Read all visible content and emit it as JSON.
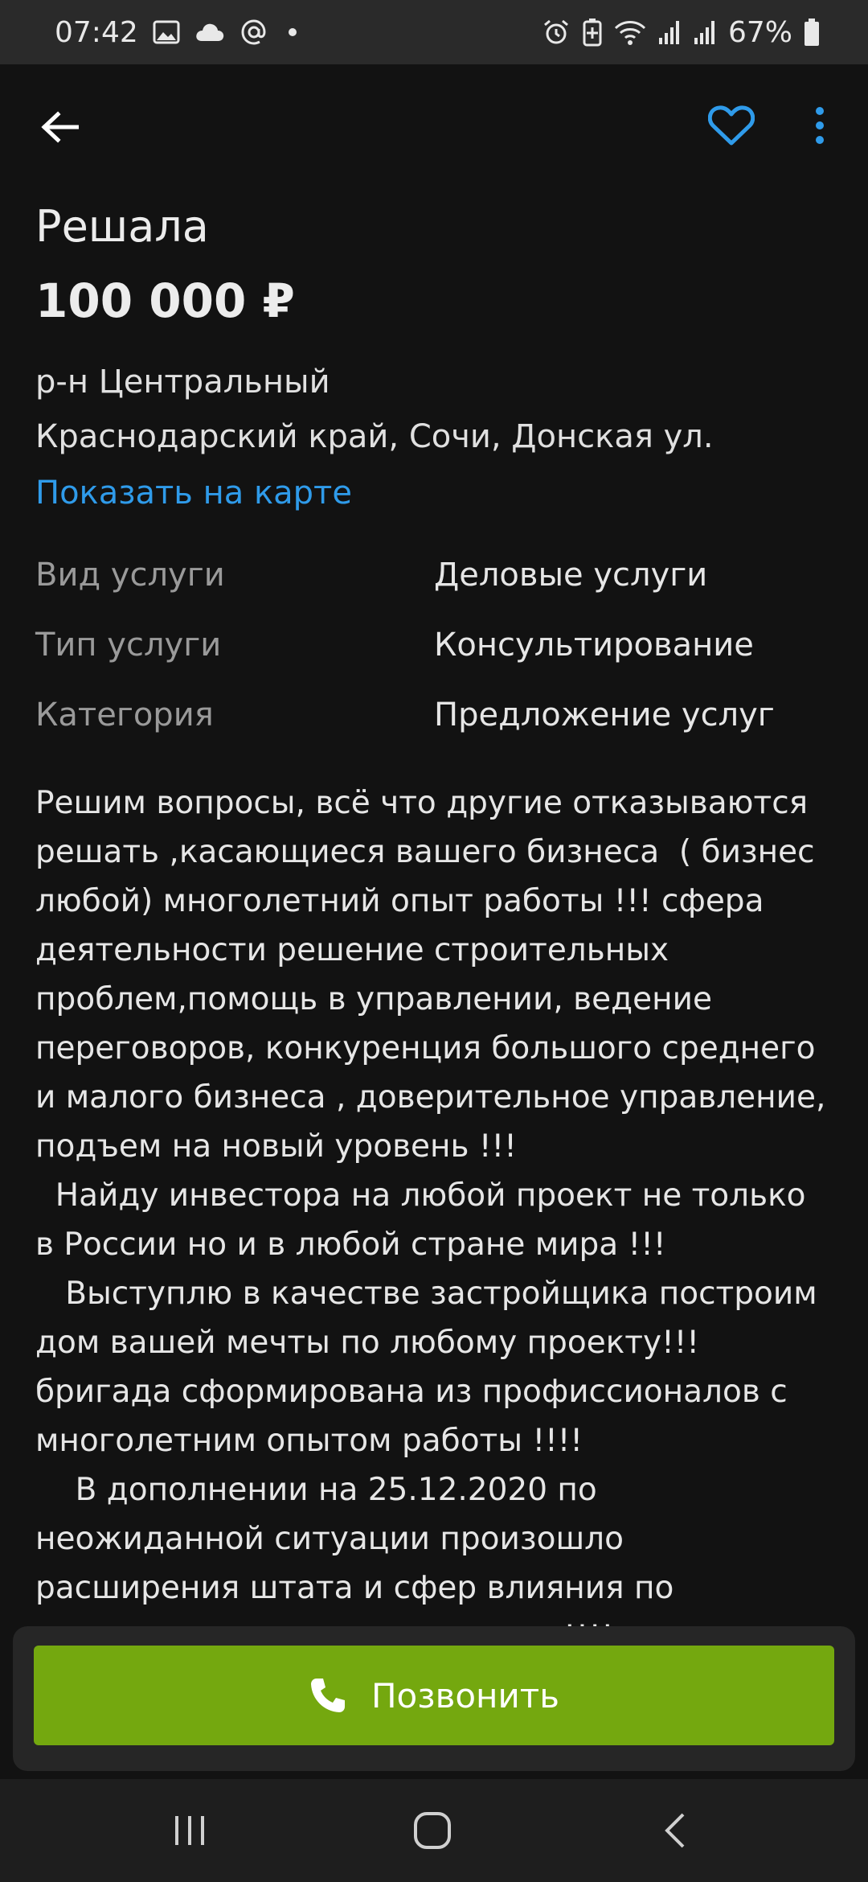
{
  "status_bar": {
    "time": "07:42",
    "battery": "67%",
    "left_icons": [
      "image-icon",
      "cloud-icon",
      "at-icon",
      "dot-icon"
    ],
    "right_icons": [
      "alarm-icon",
      "battery-saver-icon",
      "wifi-icon",
      "signal-icon",
      "signal-icon",
      "battery-icon"
    ]
  },
  "app_bar": {
    "icons": [
      "back-arrow-icon",
      "heart-icon",
      "more-vert-icon"
    ],
    "accent_color": "#2f9bea"
  },
  "listing": {
    "title": "Решала",
    "price": "100 000 ₽",
    "district": "р-н Центральный",
    "address": "Краснодарский край, Сочи, Донская ул.",
    "map_link": "Показать на карте",
    "properties": [
      {
        "label": "Вид услуги",
        "value": "Деловые услуги"
      },
      {
        "label": "Тип услуги",
        "value": "Консультирование"
      },
      {
        "label": "Категория",
        "value": "Предложение услуг"
      }
    ],
    "description": "Решим вопросы, всё что другие отказываются\nрешать ,касающиеся вашего бизнеса  ( бизнес\nлюбой) многолетний опыт работы !!! сфера\nдеятельности решение строительных\nпроблем,помощь в управлении, ведение\nпереговоров, конкуренция большого среднего\nи малого бизнеса , доверительное управление,\nподъем на новый уровень !!!\n  Найду инвестора на любой проект не только\nв России но и в любой стране мира !!!\n   Выступлю в качестве застройщика построим\nдом вашей мечты по любому проекту!!!\nбригада сформирована из профиссионалов с\nмноголетним опытом работы !!!!\n    В дополнении на 25.12.2020 по\nнеожиданной ситуации произошло\nрасширения штата и сфер влияния по\n                                                     !!!!\n\nвремя если не отвечаю пишите, перезвоню !!!"
  },
  "call": {
    "label": "Позвонить",
    "icon": "phone-icon",
    "color": "#74a80f"
  },
  "nav_bar": {
    "icons": [
      "recents-icon",
      "home-icon",
      "nav-back-icon"
    ]
  }
}
